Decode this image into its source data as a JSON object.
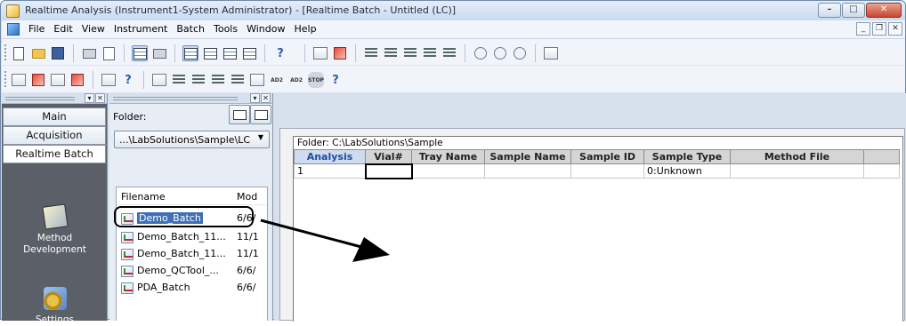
{
  "window": {
    "title": "Realtime Analysis (Instrument1-System Administrator) - [Realtime Batch - Untitled (LC)]"
  },
  "menubar": {
    "items": [
      "File",
      "Edit",
      "View",
      "Instrument",
      "Batch",
      "Tools",
      "Window",
      "Help"
    ]
  },
  "toolbar1": {
    "icons": [
      "new-icon",
      "open-icon",
      "save-icon",
      "print-icon",
      "print-preview-icon",
      "batch-table-icon",
      "binoculars-icon",
      "layout1-icon",
      "layout2-icon",
      "layout3-icon",
      "layout4-icon",
      "help-icon",
      "chart-icon",
      "instrument-icon",
      "insert-row-icon",
      "add-row-icon",
      "settings-row-icon",
      "table-icon",
      "delete-row-icon",
      "start-icon",
      "pause-icon",
      "stop-icon",
      "calculator-icon"
    ],
    "help_glyph": "?"
  },
  "toolbar2": {
    "icons": [
      "method-icon",
      "data-icon",
      "report-icon",
      "batch-icon",
      "chart-icon",
      "help-icon",
      "monitor-icon",
      "instrument-icon",
      "column-icon",
      "pump-icon",
      "detector-icon",
      "sampler-icon",
      "ad2-icon",
      "ad2-alt-icon",
      "stop-icon",
      "help-icon"
    ],
    "help_glyph": "?",
    "labels": {
      "ad2": "AD2",
      "stop": "STOP"
    }
  },
  "assistant": {
    "tabs": [
      "Main",
      "Acquisition",
      "Realtime Batch"
    ],
    "active_tab": "Realtime Batch",
    "icons": [
      {
        "label": "Method Development",
        "line1": "Method",
        "line2": "Development",
        "icon": "method-development-icon"
      },
      {
        "label": "Settings",
        "icon": "settings-icon"
      }
    ]
  },
  "folder_panel": {
    "folder_label": "Folder:",
    "folder_path": "...\\LabSolutions\\Sample\\LC",
    "columns": [
      "Filename",
      "Mod"
    ],
    "files": [
      {
        "name": "Demo_Batch",
        "modified": "6/6/"
      },
      {
        "name": "Demo_Batch_11...",
        "modified": "11/1"
      },
      {
        "name": "Demo_Batch_11...",
        "modified": "11/1"
      },
      {
        "name": "Demo_QCTool_...",
        "modified": "6/6/"
      },
      {
        "name": "PDA_Batch",
        "modified": "6/6/"
      }
    ],
    "selected_file": "Demo_Batch"
  },
  "batch_table": {
    "caption": "Folder: C:\\LabSolutions\\Sample",
    "columns": [
      "Analysis",
      "Vial#",
      "Tray Name",
      "Sample Name",
      "Sample ID",
      "Sample Type",
      "Method File",
      ""
    ],
    "rows": [
      [
        "1",
        "",
        "",
        "",
        "",
        "0:Unknown",
        "",
        ""
      ]
    ]
  },
  "colors": {
    "title_gradient_top": "#e4eefa",
    "assistant_bg": "#5b5f68",
    "selection": "#3f6fb6",
    "analysis_header": "#1d4ea1"
  }
}
